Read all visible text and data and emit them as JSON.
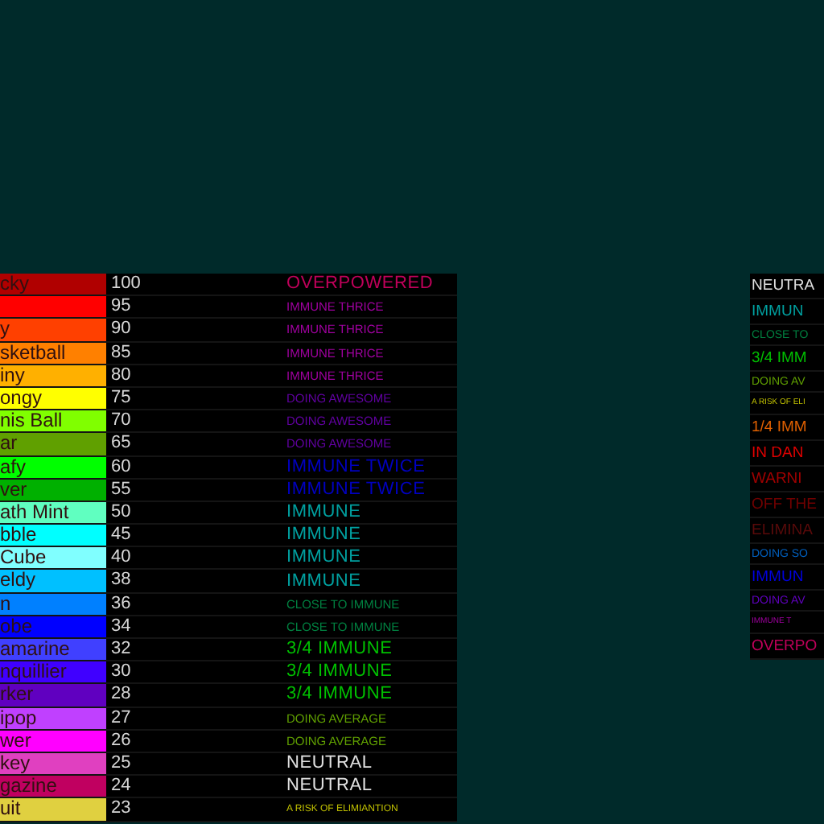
{
  "rows": [
    {
      "name": {
        "text": "cky",
        "color": "#b00000"
      },
      "value": "100",
      "status": {
        "text": "OVERPOWERED",
        "color": "#c0005a",
        "kind": "large"
      }
    },
    {
      "name": {
        "color": "#ff0000"
      },
      "value": "95",
      "status": {
        "text": "IMMUNE THRICE",
        "color": "#a000a0",
        "kind": "small"
      }
    },
    {
      "name": {
        "text": "y",
        "color": "#ff4000"
      },
      "value": "90",
      "status": {
        "text": "IMMUNE THRICE",
        "color": "#a000a0",
        "kind": "small"
      }
    },
    {
      "name": {
        "text": "sketball",
        "color": "#ff8000"
      },
      "value": "85",
      "status": {
        "text": "IMMUNE THRICE",
        "color": "#a000a0",
        "kind": "small"
      }
    },
    {
      "name": {
        "text": "iny",
        "color": "#ffb000"
      },
      "value": "80",
      "status": {
        "text": "IMMUNE THRICE",
        "color": "#a000a0",
        "kind": "small"
      }
    },
    {
      "name": {
        "text": "ongy",
        "color": "#ffff00"
      },
      "value": "75",
      "status": {
        "text": "DOING AWESOME",
        "color": "#6000a0",
        "kind": "small"
      }
    },
    {
      "name": {
        "text": "nis Ball",
        "color": "#80ff00"
      },
      "value": "70",
      "status": {
        "text": "DOING AWESOME",
        "color": "#6000a0",
        "kind": "small"
      }
    },
    {
      "name": {
        "text": "ar",
        "color": "#60a000"
      },
      "value": "65",
      "status": {
        "text": "DOING AWESOME",
        "color": "#6000a0",
        "kind": "small"
      }
    },
    {
      "name": {
        "text": "afy",
        "color": "#00ff00"
      },
      "value": "60",
      "status": {
        "text": "IMMUNE TWICE",
        "color": "#0000c0",
        "kind": "large"
      }
    },
    {
      "name": {
        "text": "ver",
        "color": "#00b000"
      },
      "value": "55",
      "status": {
        "text": "IMMUNE TWICE",
        "color": "#0000c0",
        "kind": "large"
      }
    },
    {
      "name": {
        "text": "ath Mint",
        "color": "#60ffc0"
      },
      "value": "50",
      "status": {
        "text": "IMMUNE",
        "color": "#00a0a0",
        "kind": "large"
      }
    },
    {
      "name": {
        "text": "bble",
        "color": "#00ffff"
      },
      "value": "45",
      "status": {
        "text": "IMMUNE",
        "color": "#00a0a0",
        "kind": "large"
      }
    },
    {
      "name": {
        "text": "Cube",
        "color": "#80ffff"
      },
      "value": "40",
      "status": {
        "text": "IMMUNE",
        "color": "#00a0a0",
        "kind": "large"
      }
    },
    {
      "name": {
        "text": "eldy",
        "color": "#00c0ff"
      },
      "value": "38",
      "status": {
        "text": "IMMUNE",
        "color": "#00a0a0",
        "kind": "large"
      }
    },
    {
      "name": {
        "text": "n",
        "color": "#0080ff"
      },
      "value": "36",
      "status": {
        "text": "CLOSE TO IMMUNE",
        "color": "#008040",
        "kind": "small"
      }
    },
    {
      "name": {
        "text": "obe",
        "color": "#0000ff"
      },
      "value": "34",
      "status": {
        "text": "CLOSE TO IMMUNE",
        "color": "#008040",
        "kind": "small"
      }
    },
    {
      "name": {
        "text": "amarine",
        "color": "#4040ff"
      },
      "value": "32",
      "status": {
        "text": "3/4 IMMUNE",
        "color": "#00c000",
        "kind": "large"
      }
    },
    {
      "name": {
        "text": "nquillier",
        "color": "#4000ff"
      },
      "value": "30",
      "status": {
        "text": "3/4 IMMUNE",
        "color": "#00c000",
        "kind": "large"
      }
    },
    {
      "name": {
        "text": "rker",
        "color": "#6000c0"
      },
      "value": "28",
      "status": {
        "text": "3/4 IMMUNE",
        "color": "#00c000",
        "kind": "large"
      }
    },
    {
      "name": {
        "text": "ipop",
        "color": "#c040ff"
      },
      "value": "27",
      "status": {
        "text": "DOING AVERAGE",
        "color": "#60a000",
        "kind": "small"
      }
    },
    {
      "name": {
        "text": "wer",
        "color": "#ff00ff"
      },
      "value": "26",
      "status": {
        "text": "DOING AVERAGE",
        "color": "#60a000",
        "kind": "small"
      }
    },
    {
      "name": {
        "text": "key",
        "color": "#e040c0"
      },
      "value": "25",
      "status": {
        "text": "NEUTRAL",
        "color": "#e0e0e0",
        "kind": "large"
      }
    },
    {
      "name": {
        "text": "gazine",
        "color": "#c00060"
      },
      "value": "24",
      "status": {
        "text": "NEUTRAL",
        "color": "#e0e0e0",
        "kind": "large"
      }
    },
    {
      "name": {
        "text": "uit",
        "color": "#e0d040"
      },
      "value": "23",
      "status": {
        "text": "A RISK OF ELIMIANTION",
        "color": "#c0c000",
        "kind": "tiny"
      }
    }
  ],
  "legend": [
    {
      "text": "NEUTRA",
      "color": "#e0e0e0",
      "kind": "large"
    },
    {
      "text": "IMMUN",
      "color": "#00a0a0",
      "kind": "large"
    },
    {
      "text": "CLOSE TO",
      "color": "#008040",
      "kind": "small"
    },
    {
      "text": "3/4 IMM",
      "color": "#00c000",
      "kind": "large"
    },
    {
      "text": "DOING AV",
      "color": "#60a000",
      "kind": "small"
    },
    {
      "text": "A RISK OF ELI",
      "color": "#c0c000",
      "kind": "tiny"
    },
    {
      "text": "1/4 IMM",
      "color": "#e06000",
      "kind": "large"
    },
    {
      "text": "IN DAN",
      "color": "#e00000",
      "kind": "large"
    },
    {
      "text": "WARNI",
      "color": "#a00000",
      "kind": "large"
    },
    {
      "text": "OFF THE",
      "color": "#700000",
      "kind": "large"
    },
    {
      "text": "ELIMINA",
      "color": "#5a0a0a",
      "kind": "large"
    },
    {
      "text": "DOING SO",
      "color": "#0060c0",
      "kind": "small"
    },
    {
      "text": "IMMUN",
      "color": "#0000e0",
      "kind": "large"
    },
    {
      "text": "DOING AV",
      "color": "#6000c0",
      "kind": "small"
    },
    {
      "text": "IMMUNE T",
      "color": "#a000a0",
      "kind": "tiny"
    },
    {
      "text": "OVERPO",
      "color": "#c0005a",
      "kind": "large"
    }
  ]
}
